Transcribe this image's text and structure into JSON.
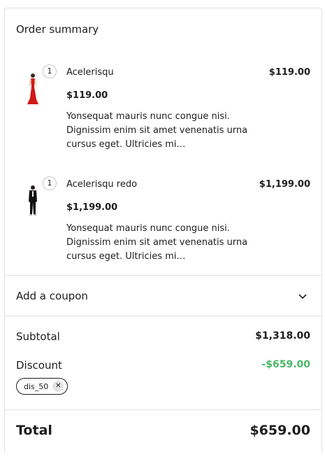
{
  "order_summary": {
    "title": "Order summary",
    "items": [
      {
        "quantity": "1",
        "name": "Acelerisqu",
        "line_total": "$119.00",
        "unit_price": "$119.00",
        "description": "Yonsequat mauris nunc congue nisi. Dignissim enim sit amet venenatis urna cursus eget. Ultricies mi…",
        "image_icon": "red-dress-product-image"
      },
      {
        "quantity": "1",
        "name": "Acelerisqu redo",
        "line_total": "$1,199.00",
        "unit_price": "$1,199.00",
        "description": "Yonsequat mauris nunc congue nisi. Dignissim enim sit amet venenatis urna cursus eget. Ultricies mi…",
        "image_icon": "black-suit-product-image"
      }
    ],
    "coupon": {
      "label": "Add a coupon",
      "icon": "chevron-down-icon"
    },
    "subtotal": {
      "label": "Subtotal",
      "value": "$1,318.00"
    },
    "discount": {
      "label": "Discount",
      "value": "-$659.00",
      "color": "#4ab866",
      "applied_code": "dis_50",
      "remove_icon": "close-icon"
    },
    "total": {
      "label": "Total",
      "value": "$659.00"
    }
  }
}
